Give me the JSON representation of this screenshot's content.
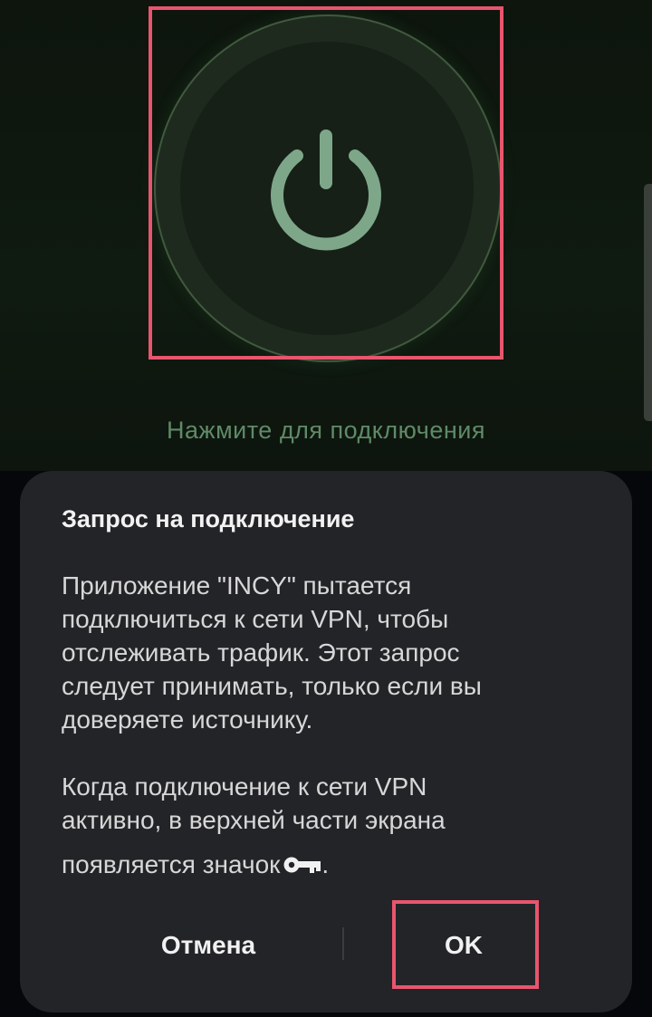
{
  "app": {
    "connect_hint": "Нажмите для подключения",
    "power_button_icon": "power-icon",
    "accent_color": "#7ea78a"
  },
  "dialog": {
    "title": "Запрос на подключение",
    "paragraph1_lines": [
      "Приложение \"INCY\" пытается",
      "подключиться к сети VPN, чтобы",
      "отслеживать трафик. Этот запрос",
      "следует принимать, только если вы",
      "доверяете источнику."
    ],
    "paragraph2_lines": [
      "Когда подключение к сети VPN",
      "активно, в верхней части экрана"
    ],
    "paragraph2_last_line": "появляется значок",
    "paragraph2_end": ".",
    "key_icon": "key-icon",
    "cancel_label": "Отмена",
    "ok_label": "OK"
  },
  "highlight_color": "#e8556e"
}
